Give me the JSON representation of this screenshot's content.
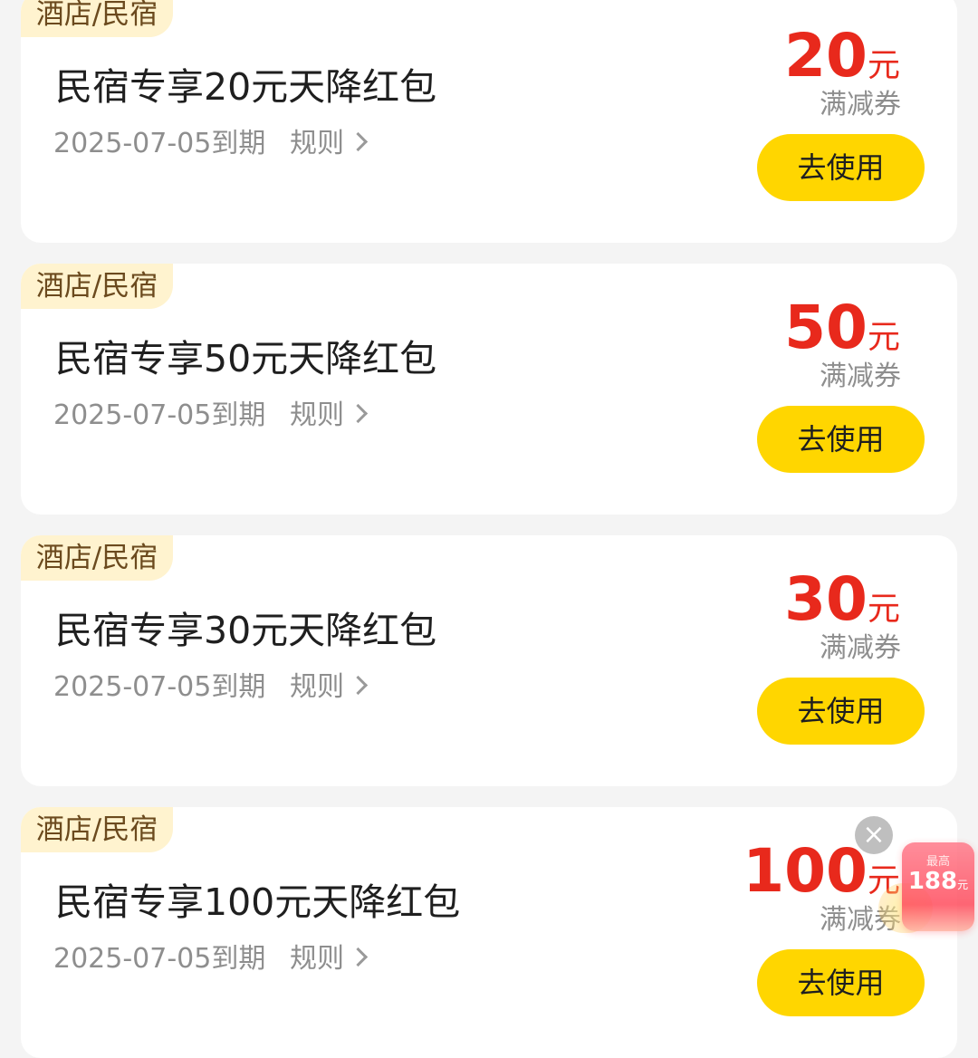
{
  "coupons": [
    {
      "category": "酒店/民宿",
      "title": "民宿专享20元天降红包",
      "expiry": "2025-07-05到期",
      "rules_label": "规则",
      "amount": "20",
      "unit": "元",
      "coupon_type": "满减券",
      "button_label": "去使用"
    },
    {
      "category": "酒店/民宿",
      "title": "民宿专享50元天降红包",
      "expiry": "2025-07-05到期",
      "rules_label": "规则",
      "amount": "50",
      "unit": "元",
      "coupon_type": "满减券",
      "button_label": "去使用"
    },
    {
      "category": "酒店/民宿",
      "title": "民宿专享30元天降红包",
      "expiry": "2025-07-05到期",
      "rules_label": "规则",
      "amount": "30",
      "unit": "元",
      "coupon_type": "满减券",
      "button_label": "去使用"
    },
    {
      "category": "酒店/民宿",
      "title": "民宿专享100元天降红包",
      "expiry": "2025-07-05到期",
      "rules_label": "规则",
      "amount": "100",
      "unit": "元",
      "coupon_type": "满减券",
      "button_label": "去使用"
    }
  ],
  "float_widget": {
    "label": "最高",
    "amount": "188",
    "unit": "元",
    "close_icon": "×"
  },
  "colors": {
    "accent_yellow": "#ffd600",
    "amount_red": "#e8291c",
    "tag_bg": "#fff3cf",
    "tag_text": "#6b4a1e"
  }
}
